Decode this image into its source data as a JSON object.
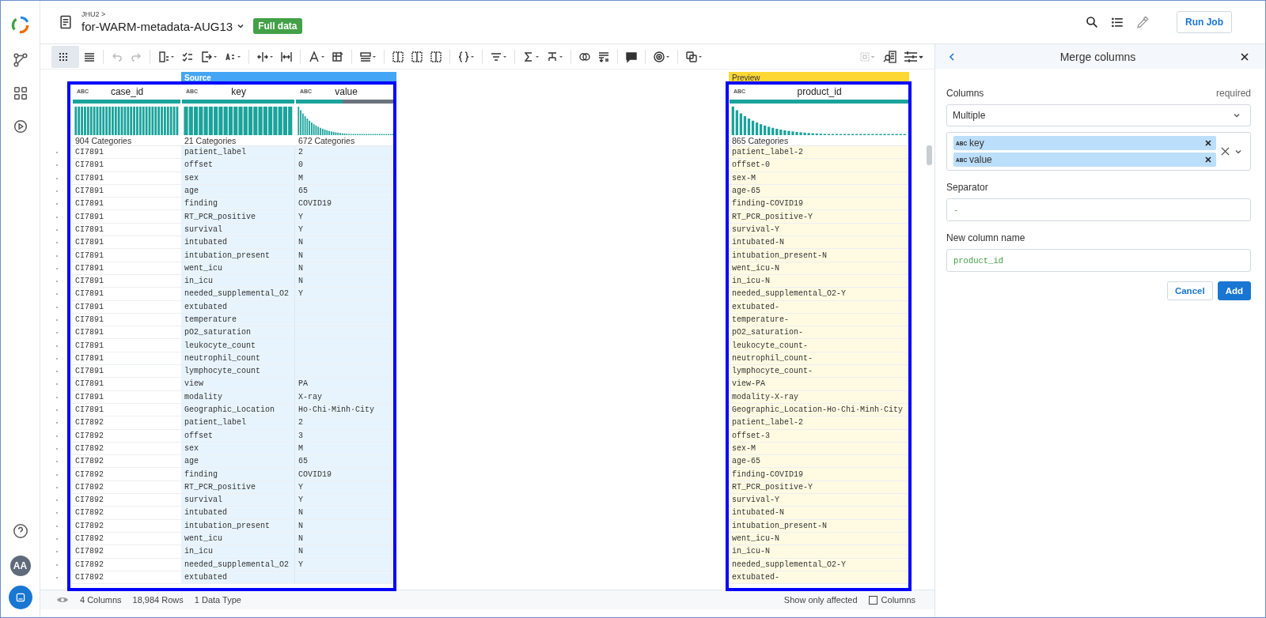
{
  "app": {
    "breadcrumb": "JHU2 >",
    "title": "for-WARM-metadata-AUG13",
    "badge": "Full data",
    "run_job": "Run Job",
    "avatar": "AA"
  },
  "table": {
    "source_band": "Source",
    "preview_band": "Preview",
    "columns": [
      {
        "type": "ABC",
        "name": "case_id",
        "categories": "904 Categories",
        "level": 1
      },
      {
        "type": "ABC",
        "name": "key",
        "categories": "21 Categories",
        "level": 1
      },
      {
        "type": "ABC",
        "name": "value",
        "categories": "672 Categories",
        "level": 0.47
      }
    ],
    "preview_column": {
      "type": "ABC",
      "name": "product_id",
      "categories": "865 Categories",
      "level": 1
    },
    "rows": [
      {
        "case_id": "CI7891",
        "key": "patient_label",
        "value": "2",
        "product_id": "patient_label-2"
      },
      {
        "case_id": "CI7891",
        "key": "offset",
        "value": "0",
        "product_id": "offset-0"
      },
      {
        "case_id": "CI7891",
        "key": "sex",
        "value": "M",
        "product_id": "sex-M"
      },
      {
        "case_id": "CI7891",
        "key": "age",
        "value": "65",
        "product_id": "age-65"
      },
      {
        "case_id": "CI7891",
        "key": "finding",
        "value": "COVID19",
        "product_id": "finding-COVID19"
      },
      {
        "case_id": "CI7891",
        "key": "RT_PCR_positive",
        "value": "Y",
        "product_id": "RT_PCR_positive-Y"
      },
      {
        "case_id": "CI7891",
        "key": "survival",
        "value": "Y",
        "product_id": "survival-Y"
      },
      {
        "case_id": "CI7891",
        "key": "intubated",
        "value": "N",
        "product_id": "intubated-N"
      },
      {
        "case_id": "CI7891",
        "key": "intubation_present",
        "value": "N",
        "product_id": "intubation_present-N"
      },
      {
        "case_id": "CI7891",
        "key": "went_icu",
        "value": "N",
        "product_id": "went_icu-N"
      },
      {
        "case_id": "CI7891",
        "key": "in_icu",
        "value": "N",
        "product_id": "in_icu-N"
      },
      {
        "case_id": "CI7891",
        "key": "needed_supplemental_O2",
        "value": "Y",
        "product_id": "needed_supplemental_O2-Y"
      },
      {
        "case_id": "CI7891",
        "key": "extubated",
        "product_id": "extubated-"
      },
      {
        "case_id": "CI7891",
        "key": "temperature",
        "product_id": "temperature-"
      },
      {
        "case_id": "CI7891",
        "key": "pO2_saturation",
        "product_id": "pO2_saturation-"
      },
      {
        "case_id": "CI7891",
        "key": "leukocyte_count",
        "product_id": "leukocyte_count-"
      },
      {
        "case_id": "CI7891",
        "key": "neutrophil_count",
        "product_id": "neutrophil_count-"
      },
      {
        "case_id": "CI7891",
        "key": "lymphocyte_count",
        "product_id": "lymphocyte_count-"
      },
      {
        "case_id": "CI7891",
        "key": "view",
        "value": "PA",
        "product_id": "view-PA"
      },
      {
        "case_id": "CI7891",
        "key": "modality",
        "value": "X-ray",
        "product_id": "modality-X-ray"
      },
      {
        "case_id": "CI7891",
        "key": "Geographic_Location",
        "value": "Ho·Chi·Minh·City",
        "product_id": "Geographic_Location-Ho·Chi·Minh·City"
      },
      {
        "case_id": "CI7892",
        "key": "patient_label",
        "value": "2",
        "product_id": "patient_label-2"
      },
      {
        "case_id": "CI7892",
        "key": "offset",
        "value": "3",
        "product_id": "offset-3"
      },
      {
        "case_id": "CI7892",
        "key": "sex",
        "value": "M",
        "product_id": "sex-M"
      },
      {
        "case_id": "CI7892",
        "key": "age",
        "value": "65",
        "product_id": "age-65"
      },
      {
        "case_id": "CI7892",
        "key": "finding",
        "value": "COVID19",
        "product_id": "finding-COVID19"
      },
      {
        "case_id": "CI7892",
        "key": "RT_PCR_positive",
        "value": "Y",
        "product_id": "RT_PCR_positive-Y"
      },
      {
        "case_id": "CI7892",
        "key": "survival",
        "value": "Y",
        "product_id": "survival-Y"
      },
      {
        "case_id": "CI7892",
        "key": "intubated",
        "value": "N",
        "product_id": "intubated-N"
      },
      {
        "case_id": "CI7892",
        "key": "intubation_present",
        "value": "N",
        "product_id": "intubation_present-N"
      },
      {
        "case_id": "CI7892",
        "key": "went_icu",
        "value": "N",
        "product_id": "went_icu-N"
      },
      {
        "case_id": "CI7892",
        "key": "in_icu",
        "value": "N",
        "product_id": "in_icu-N"
      },
      {
        "case_id": "CI7892",
        "key": "needed_supplemental_O2",
        "value": "Y",
        "product_id": "needed_supplemental_O2-Y"
      },
      {
        "case_id": "CI7892",
        "key": "extubated",
        "product_id": "extubated-"
      }
    ]
  },
  "status_bar": {
    "columns": "4 Columns",
    "rows": "18,984 Rows",
    "types": "1 Data Type",
    "filter": "Show only affected",
    "columns_toggle": {
      "label": "Columns",
      "checked": false
    }
  },
  "panel": {
    "title": "Merge columns",
    "columns_label": "Columns",
    "required": "required",
    "mode": "Multiple",
    "chips": [
      {
        "type": "ABC",
        "label": "key"
      },
      {
        "type": "ABC",
        "label": "value"
      }
    ],
    "separator_label": "Separator",
    "separator": "-",
    "name_label": "New column name",
    "name": "product_id",
    "cancel": "Cancel",
    "add": "Add"
  }
}
